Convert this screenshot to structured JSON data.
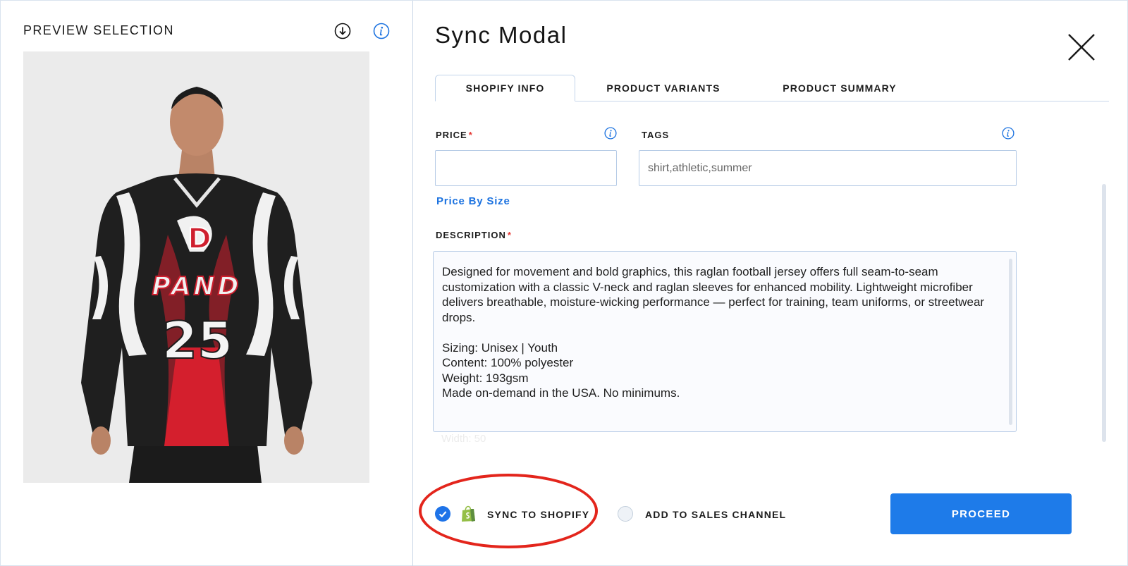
{
  "left_panel": {
    "title": "PREVIEW SELECTION",
    "download_icon": "download-icon",
    "info_icon": "info-icon",
    "preview_image": {
      "jersey_front_text": "PAND",
      "jersey_logo_letter": "D",
      "jersey_number": "25"
    }
  },
  "modal": {
    "title": "Sync Modal",
    "close_icon": "close-icon"
  },
  "tabs": [
    {
      "label": "SHOPIFY INFO",
      "active": true
    },
    {
      "label": "PRODUCT VARIANTS",
      "active": false
    },
    {
      "label": "PRODUCT SUMMARY",
      "active": false
    }
  ],
  "form": {
    "price": {
      "label": "PRICE",
      "required_mark": "*",
      "value": "",
      "info_icon": "info-icon"
    },
    "tags": {
      "label": "TAGS",
      "value": "shirt,athletic,summer",
      "info_icon": "info-icon"
    },
    "price_by_size_link": "Price By Size",
    "description": {
      "label": "DESCRIPTION",
      "required_mark": "*",
      "paragraph": "Designed for movement and bold graphics, this raglan football jersey offers full seam-to-seam customization with a classic V-neck and raglan sleeves for enhanced mobility. Lightweight microfiber delivers breathable, moisture-wicking performance — perfect for training, team uniforms, or streetwear drops.",
      "lines": [
        "Sizing: Unisex | Youth",
        "Content: 100% polyester",
        "Weight: 193gsm",
        "Made on-demand in the USA. No minimums."
      ]
    },
    "faded_text": "Width: 50"
  },
  "footer": {
    "sync_to_shopify": {
      "label": "SYNC TO SHOPIFY",
      "checked": true,
      "icon": "shopify-bag-icon"
    },
    "add_to_sales_channel": {
      "label": "ADD TO SALES CHANNEL",
      "checked": false
    },
    "proceed_label": "PROCEED"
  },
  "colors": {
    "accent_blue": "#1e7be9",
    "highlight_ring_red": "#e3251c",
    "shopify_green": "#95bf47",
    "required_red": "#e53935"
  }
}
